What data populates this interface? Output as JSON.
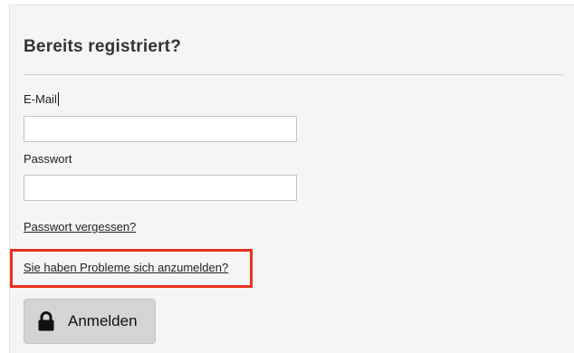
{
  "login_panel": {
    "title": "Bereits registriert?",
    "email_label": "E-Mail",
    "email_value": "",
    "password_label": "Passwort",
    "password_value": "",
    "forgot_password_link": "Passwort vergessen?",
    "login_problems_link": "Sie haben Probleme sich anzumelden?",
    "login_button_label": "Anmelden",
    "login_button_icon": "lock-icon"
  },
  "colors": {
    "panel_background": "#f5f5f5",
    "highlight_border": "#e8321e",
    "button_background": "#d4d4d4"
  }
}
